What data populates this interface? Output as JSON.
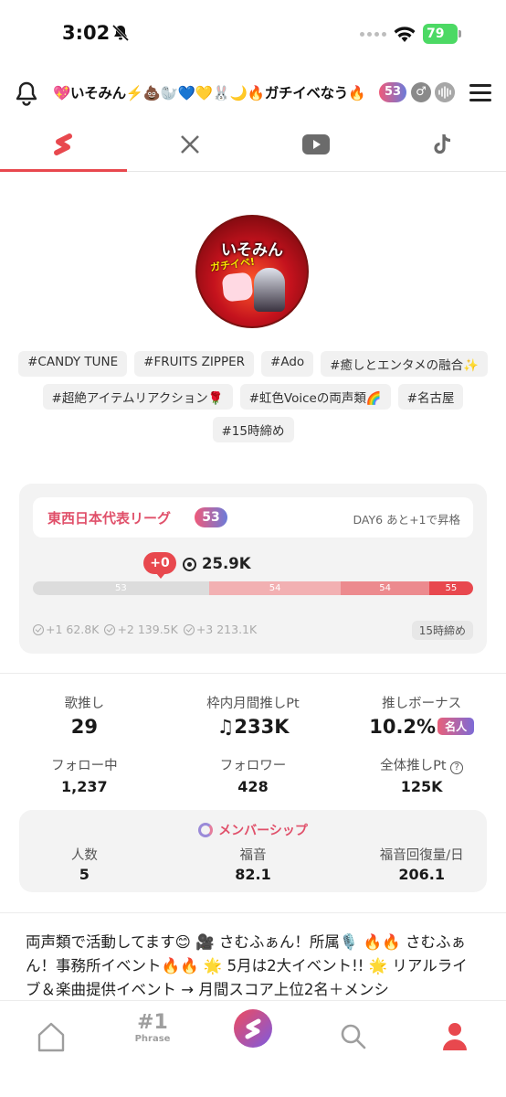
{
  "status_bar": {
    "time": "3:02",
    "battery": "79"
  },
  "header": {
    "title": "💖いそみん⚡️💩🦭💙💛🐰🌙🔥ガチイベなう🔥",
    "level": "53",
    "gender_symbol": "♂"
  },
  "tabs": [
    {
      "name": "stand-fm",
      "glyph": "S",
      "active": true
    },
    {
      "name": "x",
      "glyph": "X",
      "active": false
    },
    {
      "name": "youtube",
      "glyph": "▶",
      "active": false
    },
    {
      "name": "tiktok",
      "glyph": "♪",
      "active": false
    }
  ],
  "avatar": {
    "title": "いそみん",
    "sub": "ガチイベ!"
  },
  "tags": [
    "#CANDY TUNE",
    "#FRUITS ZIPPER",
    "#Ado",
    "#癒しとエンタメの融合✨",
    "#超絶アイテムリアクション🌹",
    "#虹色Voiceの両声類🌈",
    "#名古屋",
    "#15時締め"
  ],
  "league": {
    "name": "東西日本代表リーグ",
    "rank": "53",
    "status": "DAY6 あと+1で昇格",
    "delta": "+0",
    "score": "25.9K",
    "progress_segments": [
      {
        "label": "53",
        "fraction": 0.4,
        "color": "#dcdcdc"
      },
      {
        "label": "54",
        "fraction": 0.3,
        "color": "#f2b0b2"
      },
      {
        "label": "54",
        "fraction": 0.2,
        "color": "#ec8a8e"
      },
      {
        "label": "55",
        "fraction": 0.1,
        "color": "#e8484e"
      }
    ],
    "milestones": [
      "+1 62.8K",
      "+2 139.5K",
      "+3 213.1K"
    ],
    "deadline": "15時締め"
  },
  "stats_row1": [
    {
      "label": "歌推し",
      "value": "29"
    },
    {
      "label": "枠内月間推しPt",
      "value": "♫233K"
    },
    {
      "label": "推しボーナス",
      "value": "10.2%",
      "badge": "名人"
    }
  ],
  "stats_row2": [
    {
      "label": "フォロー中",
      "value": "1,237"
    },
    {
      "label": "フォロワー",
      "value": "428"
    },
    {
      "label": "全体推しPt",
      "value": "125K"
    }
  ],
  "membership": {
    "title": "メンバーシップ",
    "stats": [
      {
        "label": "人数",
        "value": "5"
      },
      {
        "label": "福音",
        "value": "82.1"
      },
      {
        "label": "福音回復量/日",
        "value": "206.1"
      }
    ]
  },
  "bio": "両声類で活動してます😊 🎥 さむふぁん！所属🎙️ 🔥🔥 さむふぁん！事務所イベント🔥🔥 🌟 5月は2大イベント!! 🌟 リアルライブ＆楽曲提供イベント → 月間スコア上位2名＋メンシ",
  "bottom_nav": {
    "rank_num": "#1",
    "rank_label": "Phrase"
  }
}
